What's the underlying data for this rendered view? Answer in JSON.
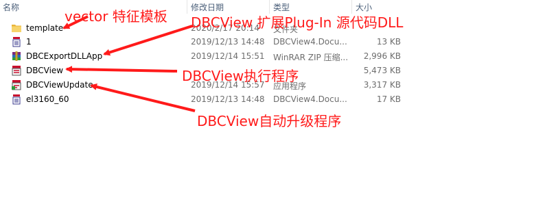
{
  "columns": {
    "name": "名称",
    "modified": "修改日期",
    "type": "类型",
    "size": "大小"
  },
  "files": [
    {
      "name": "template",
      "modified": "2020/2/17 20:14",
      "type": "文件夹",
      "size": "",
      "icon": "folder-icon"
    },
    {
      "name": "1",
      "modified": "2019/12/13 14:48",
      "type": "DBCView4.Docu...",
      "size": "13 KB",
      "icon": "dbc-document-icon"
    },
    {
      "name": "DBCExportDLLApp",
      "modified": "2019/12/14 15:51",
      "type": "WinRAR ZIP 压缩...",
      "size": "2,996 KB",
      "icon": "winrar-archive-icon"
    },
    {
      "name": "DBCView",
      "modified": "",
      "type": "",
      "size": "5,473 KB",
      "icon": "dbc-application-icon"
    },
    {
      "name": "DBCViewUpdate",
      "modified": "2019/12/14 15:57",
      "type": "应用程序",
      "size": "3,317 KB",
      "icon": "dbc-update-application-icon"
    },
    {
      "name": "el3160_60",
      "modified": "2019/12/13 14:48",
      "type": "DBCView4.Docu...",
      "size": "17 KB",
      "icon": "dbc-document-icon"
    }
  ],
  "annotations": {
    "template": "vector 特征模板",
    "plugin": "DBCView 扩展Plug-In 源代码DLL",
    "exe": "DBCView执行程序",
    "update": "DBCView自动升级程序"
  },
  "colors": {
    "annotation": "#ff1a1a",
    "folder": "#f2c544",
    "header_text": "#4c607a"
  }
}
